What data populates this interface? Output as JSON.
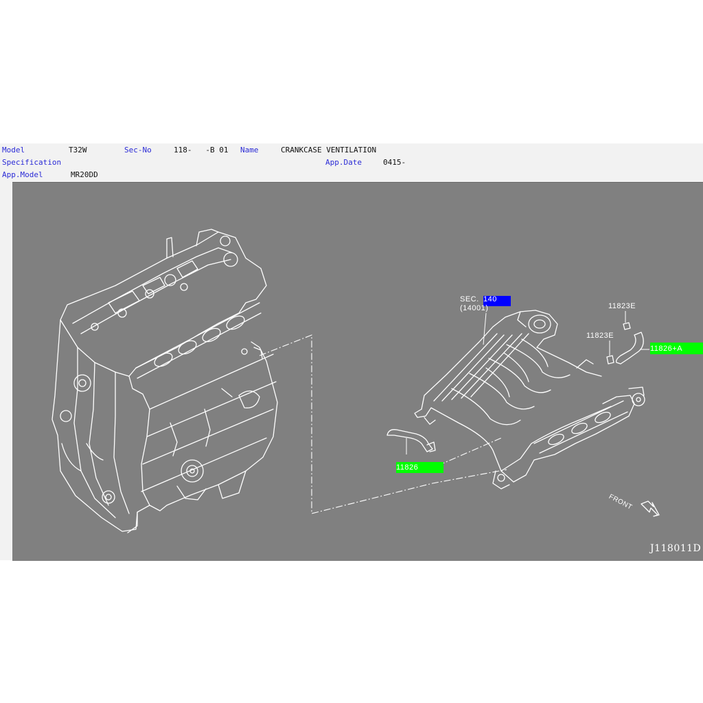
{
  "header": {
    "model_label": "Model",
    "model_value": "T32W",
    "secno_label": "Sec-No",
    "secno_value": "118-   -B 01",
    "name_label": "Name",
    "name_value": "CRANKCASE VENTILATION",
    "spec_label": "Specification",
    "spec_value": "",
    "appdate_label": "App.Date",
    "appdate_value": "0415-",
    "appmodel_label": "App.Model",
    "appmodel_value": "MR20DD"
  },
  "diagram": {
    "sec_ref_line1": "SEC.",
    "sec_ref_num": "140",
    "sec_ref_line2": "(14001)",
    "part_11823e_top": "11823E",
    "part_11823e_mid": "11823E",
    "part_11826a": "11826+A",
    "part_11826": "11826",
    "front_label": "FRONT",
    "drawing_number": "J118011D"
  },
  "colors": {
    "canvas_bg": "#808080",
    "hotspot_green": "#00ff00",
    "hotspot_blue": "#0000ff",
    "label_blue": "#2b2bd6"
  }
}
